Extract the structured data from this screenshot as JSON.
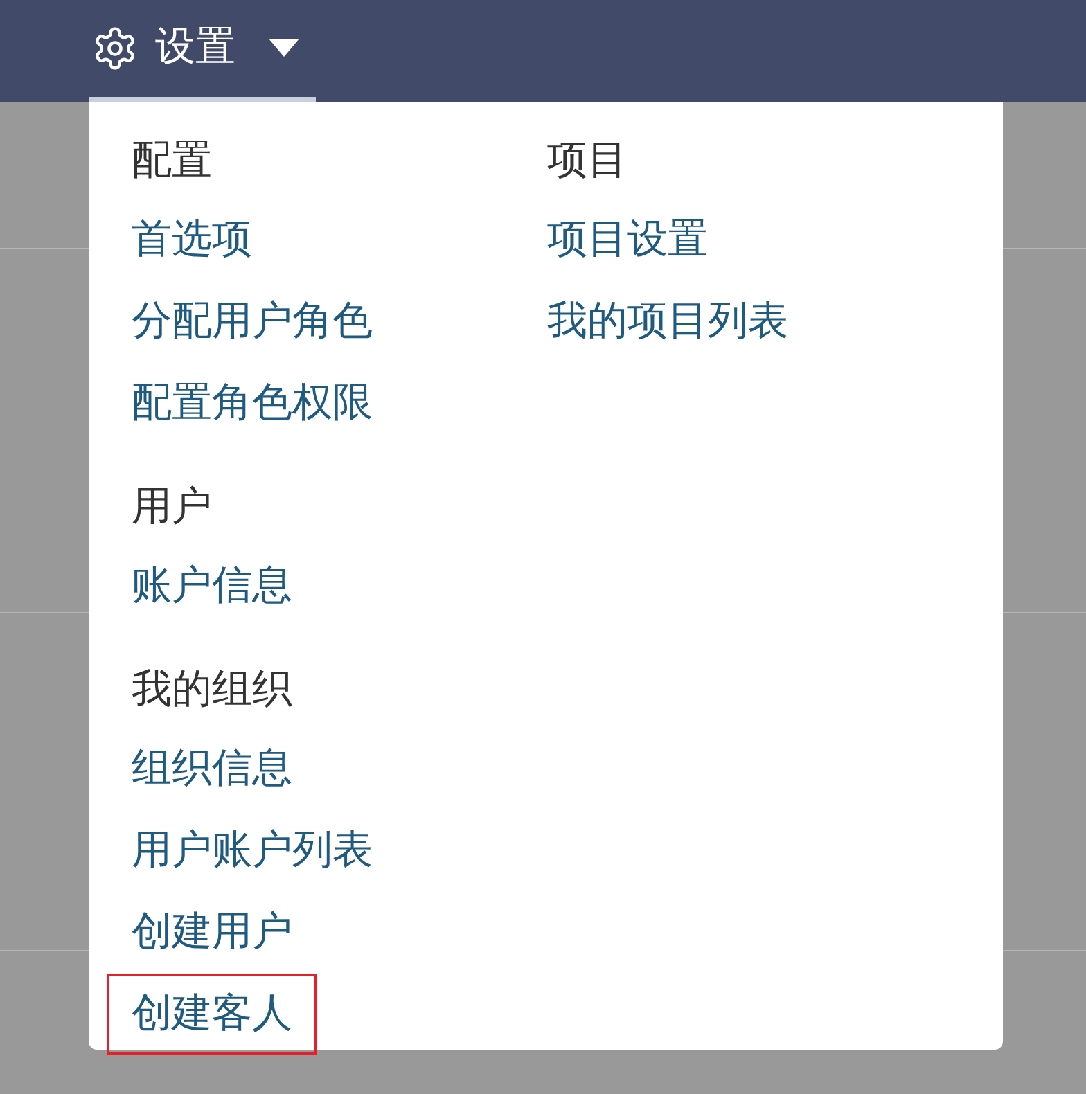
{
  "top_bar": {
    "menu_label": "设置",
    "expanded": true
  },
  "menu_columns": [
    {
      "sections": [
        {
          "heading": "配置",
          "items": [
            {
              "label": "首选项",
              "highlighted": false
            },
            {
              "label": "分配用户角色",
              "highlighted": false
            },
            {
              "label": "配置角色权限",
              "highlighted": false
            }
          ]
        },
        {
          "heading": "用户",
          "items": [
            {
              "label": "账户信息",
              "highlighted": false
            }
          ]
        },
        {
          "heading": "我的组织",
          "items": [
            {
              "label": "组织信息",
              "highlighted": false
            },
            {
              "label": "用户账户列表",
              "highlighted": false
            },
            {
              "label": "创建用户",
              "highlighted": false
            },
            {
              "label": "创建客人",
              "highlighted": true
            }
          ]
        }
      ]
    },
    {
      "sections": [
        {
          "heading": "项目",
          "items": [
            {
              "label": "项目设置",
              "highlighted": false
            },
            {
              "label": "我的项目列表",
              "highlighted": false
            }
          ]
        }
      ]
    }
  ]
}
